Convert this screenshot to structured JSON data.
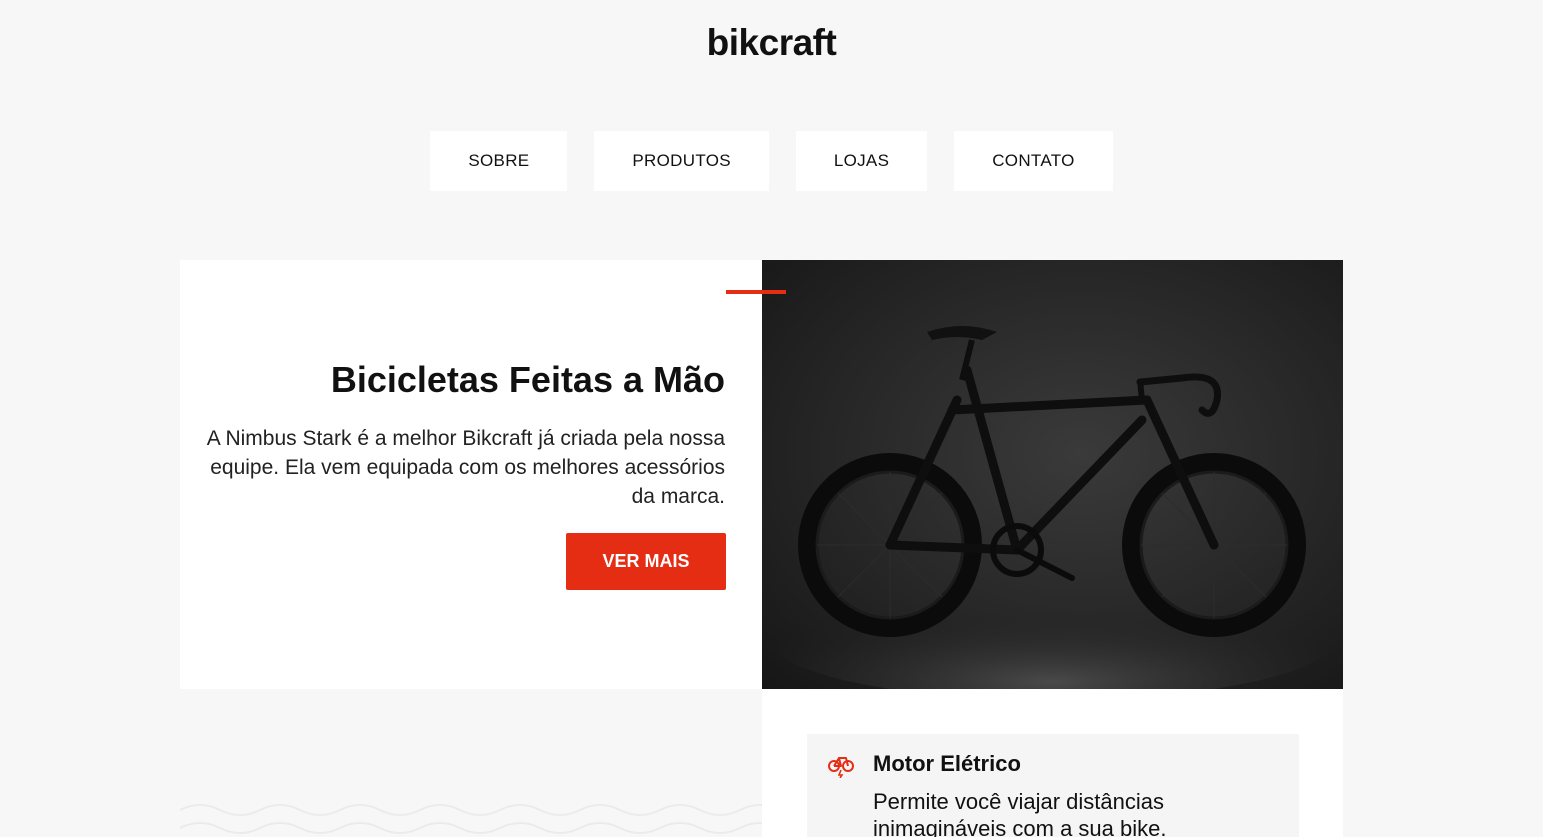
{
  "header": {
    "logo": "bikcraft"
  },
  "nav": {
    "items": [
      {
        "label": "SOBRE"
      },
      {
        "label": "PRODUTOS"
      },
      {
        "label": "LOJAS"
      },
      {
        "label": "CONTATO"
      }
    ]
  },
  "hero": {
    "title": "Bicicletas Feitas a Mão",
    "description": "A Nimbus Stark é a melhor Bikcraft já criada pela nossa equipe. Ela vem equipada com os melhores acessórios da marca.",
    "button_label": "VER MAIS",
    "image_icon": "bicycle-photo"
  },
  "features": [
    {
      "icon": "electric-bike-icon",
      "title": "Motor Elétrico",
      "description": "Permite você viajar distâncias inimagináveis com a sua bike."
    }
  ],
  "colors": {
    "accent": "#e52d14",
    "background": "#f7f7f7",
    "card": "#ffffff"
  }
}
